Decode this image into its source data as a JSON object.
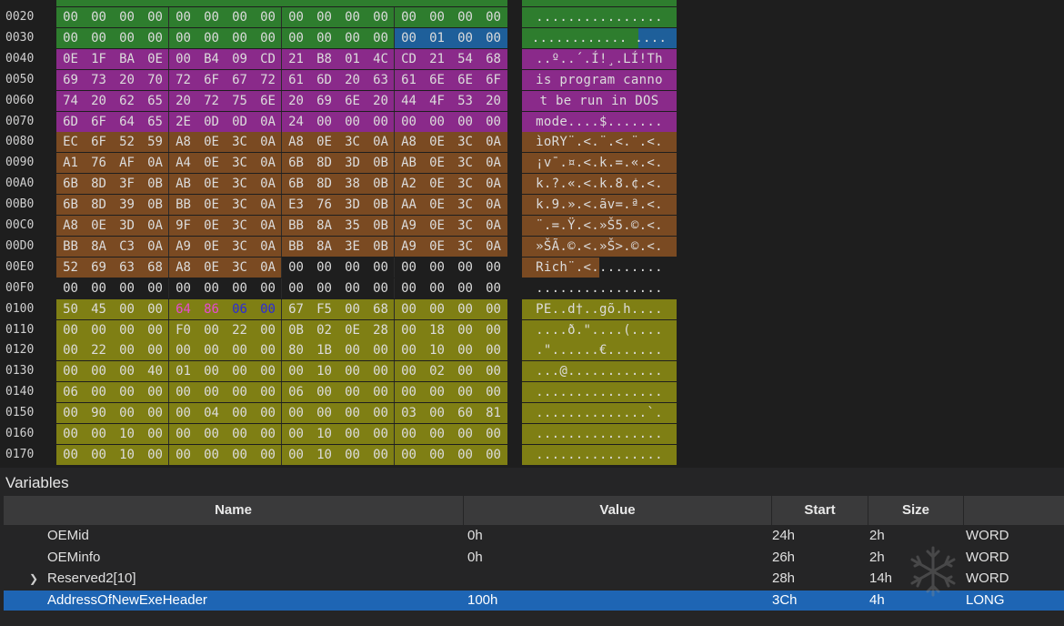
{
  "hex_rows": [
    {
      "offset": "0020",
      "bytes": [
        "00",
        "00",
        "00",
        "00",
        "00",
        "00",
        "00",
        "00",
        "00",
        "00",
        "00",
        "00",
        "00",
        "00",
        "00",
        "00"
      ],
      "ascii": "................",
      "color": "#2e7d2e",
      "cells": null
    },
    {
      "offset": "0030",
      "bytes": [
        "00",
        "00",
        "00",
        "00",
        "00",
        "00",
        "00",
        "00",
        "00",
        "00",
        "00",
        "00",
        "00",
        "01",
        "00",
        "00"
      ],
      "ascii": "............ ....",
      "color": "#2e7d2e",
      "cells": "hl30"
    },
    {
      "offset": "0040",
      "bytes": [
        "0E",
        "1F",
        "BA",
        "0E",
        "00",
        "B4",
        "09",
        "CD",
        "21",
        "B8",
        "01",
        "4C",
        "CD",
        "21",
        "54",
        "68"
      ],
      "ascii": "..º..´.Í!¸.LÍ!Th",
      "color": "#8a2a8a",
      "cells": null
    },
    {
      "offset": "0050",
      "bytes": [
        "69",
        "73",
        "20",
        "70",
        "72",
        "6F",
        "67",
        "72",
        "61",
        "6D",
        "20",
        "63",
        "61",
        "6E",
        "6E",
        "6F"
      ],
      "ascii": "is program canno",
      "color": "#8a2a8a",
      "cells": null
    },
    {
      "offset": "0060",
      "bytes": [
        "74",
        "20",
        "62",
        "65",
        "20",
        "72",
        "75",
        "6E",
        "20",
        "69",
        "6E",
        "20",
        "44",
        "4F",
        "53",
        "20"
      ],
      "ascii": "t be run in DOS ",
      "color": "#8a2a8a",
      "cells": null
    },
    {
      "offset": "0070",
      "bytes": [
        "6D",
        "6F",
        "64",
        "65",
        "2E",
        "0D",
        "0D",
        "0A",
        "24",
        "00",
        "00",
        "00",
        "00",
        "00",
        "00",
        "00"
      ],
      "ascii": "mode....$.......",
      "color": "#8a2a8a",
      "cells": null
    },
    {
      "offset": "0080",
      "bytes": [
        "EC",
        "6F",
        "52",
        "59",
        "A8",
        "0E",
        "3C",
        "0A",
        "A8",
        "0E",
        "3C",
        "0A",
        "A8",
        "0E",
        "3C",
        "0A"
      ],
      "ascii": "ìoRY¨.<.¨.<.¨.<.",
      "color": "#7a4a22",
      "cells": null
    },
    {
      "offset": "0090",
      "bytes": [
        "A1",
        "76",
        "AF",
        "0A",
        "A4",
        "0E",
        "3C",
        "0A",
        "6B",
        "8D",
        "3D",
        "0B",
        "AB",
        "0E",
        "3C",
        "0A"
      ],
      "ascii": "¡v¯.¤.<.k.=.«.<.",
      "color": "#7a4a22",
      "cells": null
    },
    {
      "offset": "00A0",
      "bytes": [
        "6B",
        "8D",
        "3F",
        "0B",
        "AB",
        "0E",
        "3C",
        "0A",
        "6B",
        "8D",
        "38",
        "0B",
        "A2",
        "0E",
        "3C",
        "0A"
      ],
      "ascii": "k.?.«.<.k.8.¢.<.",
      "color": "#7a4a22",
      "cells": null
    },
    {
      "offset": "00B0",
      "bytes": [
        "6B",
        "8D",
        "39",
        "0B",
        "BB",
        "0E",
        "3C",
        "0A",
        "E3",
        "76",
        "3D",
        "0B",
        "AA",
        "0E",
        "3C",
        "0A"
      ],
      "ascii": "k.9.».<.ãv=.ª.<.",
      "color": "#7a4a22",
      "cells": null
    },
    {
      "offset": "00C0",
      "bytes": [
        "A8",
        "0E",
        "3D",
        "0A",
        "9F",
        "0E",
        "3C",
        "0A",
        "BB",
        "8A",
        "35",
        "0B",
        "A9",
        "0E",
        "3C",
        "0A"
      ],
      "ascii": "¨.=.Ÿ.<.»Š5.©.<.",
      "color": "#7a4a22",
      "cells": null
    },
    {
      "offset": "00D0",
      "bytes": [
        "BB",
        "8A",
        "C3",
        "0A",
        "A9",
        "0E",
        "3C",
        "0A",
        "BB",
        "8A",
        "3E",
        "0B",
        "A9",
        "0E",
        "3C",
        "0A"
      ],
      "ascii": "»ŠÃ.©.<.»Š>.©.<.",
      "color": "#7a4a22",
      "cells": null
    },
    {
      "offset": "00E0",
      "bytes": [
        "52",
        "69",
        "63",
        "68",
        "A8",
        "0E",
        "3C",
        "0A",
        "00",
        "00",
        "00",
        "00",
        "00",
        "00",
        "00",
        "00"
      ],
      "ascii": "Rich¨.<.........",
      "color": "#7a4a22",
      "cells": "half"
    },
    {
      "offset": "00F0",
      "bytes": [
        "00",
        "00",
        "00",
        "00",
        "00",
        "00",
        "00",
        "00",
        "00",
        "00",
        "00",
        "00",
        "00",
        "00",
        "00",
        "00"
      ],
      "ascii": "................",
      "color": "#1e1e1e",
      "cells": null
    },
    {
      "offset": "0100",
      "bytes": [
        "50",
        "45",
        "00",
        "00",
        "64",
        "86",
        "06",
        "00",
        "67",
        "F5",
        "00",
        "68",
        "00",
        "00",
        "00",
        "00"
      ],
      "ascii": "PE..d†..gõ.h....",
      "color": "#7f7f14",
      "cells": "pe"
    },
    {
      "offset": "0110",
      "bytes": [
        "00",
        "00",
        "00",
        "00",
        "F0",
        "00",
        "22",
        "00",
        "0B",
        "02",
        "0E",
        "28",
        "00",
        "18",
        "00",
        "00"
      ],
      "ascii": "....ð.\"....(....",
      "color": "#7f7f14",
      "cells": null
    },
    {
      "offset": "0120",
      "bytes": [
        "00",
        "22",
        "00",
        "00",
        "00",
        "00",
        "00",
        "00",
        "80",
        "1B",
        "00",
        "00",
        "00",
        "10",
        "00",
        "00"
      ],
      "ascii": ".\"......€.......",
      "color": "#7f7f14",
      "cells": null
    },
    {
      "offset": "0130",
      "bytes": [
        "00",
        "00",
        "00",
        "40",
        "01",
        "00",
        "00",
        "00",
        "00",
        "10",
        "00",
        "00",
        "00",
        "02",
        "00",
        "00"
      ],
      "ascii": "...@............",
      "color": "#7f7f14",
      "cells": null
    },
    {
      "offset": "0140",
      "bytes": [
        "06",
        "00",
        "00",
        "00",
        "00",
        "00",
        "00",
        "00",
        "06",
        "00",
        "00",
        "00",
        "00",
        "00",
        "00",
        "00"
      ],
      "ascii": "................",
      "color": "#7f7f14",
      "cells": null
    },
    {
      "offset": "0150",
      "bytes": [
        "00",
        "90",
        "00",
        "00",
        "00",
        "04",
        "00",
        "00",
        "00",
        "00",
        "00",
        "00",
        "03",
        "00",
        "60",
        "81"
      ],
      "ascii": "..............`.",
      "color": "#7f7f14",
      "cells": null
    },
    {
      "offset": "0160",
      "bytes": [
        "00",
        "00",
        "10",
        "00",
        "00",
        "00",
        "00",
        "00",
        "00",
        "10",
        "00",
        "00",
        "00",
        "00",
        "00",
        "00"
      ],
      "ascii": "................",
      "color": "#7f7f14",
      "cells": null
    },
    {
      "offset": "0170",
      "bytes": [
        "00",
        "00",
        "10",
        "00",
        "00",
        "00",
        "00",
        "00",
        "00",
        "10",
        "00",
        "00",
        "00",
        "00",
        "00",
        "00"
      ],
      "ascii": "................",
      "color": "#7f7f14",
      "cells": null
    }
  ],
  "variables": {
    "title": "Variables",
    "columns": {
      "name": "Name",
      "value": "Value",
      "start": "Start",
      "size": "Size",
      "type": ""
    },
    "rows": [
      {
        "name": "OEMid",
        "value": "0h",
        "start": "24h",
        "size": "2h",
        "type": "WORD",
        "expandable": false,
        "selected": false
      },
      {
        "name": "OEMinfo",
        "value": "0h",
        "start": "26h",
        "size": "2h",
        "type": "WORD",
        "expandable": false,
        "selected": false
      },
      {
        "name": "Reserved2[10]",
        "value": "",
        "start": "28h",
        "size": "14h",
        "type": "WORD",
        "expandable": true,
        "selected": false
      },
      {
        "name": "AddressOfNewExeHeader",
        "value": "100h",
        "start": "3Ch",
        "size": "4h",
        "type": "LONG",
        "expandable": false,
        "selected": true
      }
    ]
  },
  "colors": {
    "dos_header": "#2e7d2e",
    "dos_stub": "#8a2a8a",
    "rich_header": "#7a4a22",
    "nt_headers": "#7f7f14",
    "selected_field": "#1e5f9a",
    "selection_row": "#1e65b4"
  },
  "watermark_icon": "snowflake-icon"
}
